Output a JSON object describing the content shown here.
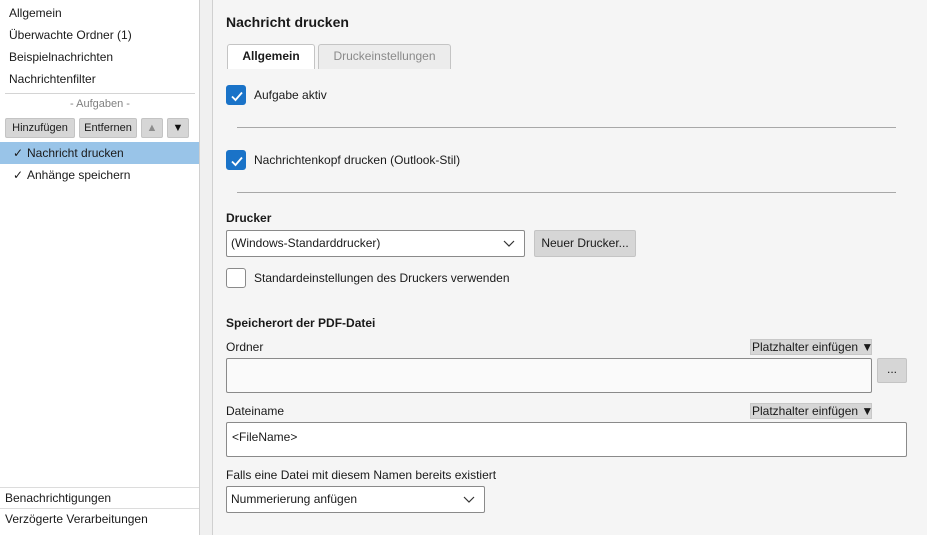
{
  "sidebar": {
    "nav_items": [
      "Allgemein",
      "Überwachte Ordner (1)",
      "Beispielnachrichten",
      "Nachrichtenfilter"
    ],
    "tasks_header": "- Aufgaben -",
    "toolbar": {
      "add_label": "Hinzufügen",
      "remove_label": "Entfernen",
      "up_glyph": "▲",
      "down_glyph": "▼"
    },
    "tasks": [
      {
        "check": "✓",
        "label": "Nachricht drucken",
        "selected": true
      },
      {
        "check": "✓",
        "label": "Anhänge speichern",
        "selected": false
      }
    ],
    "bottom_items": [
      "Benachrichtigungen",
      "Verzögerte Verarbeitungen"
    ]
  },
  "main": {
    "title": "Nachricht drucken",
    "tabs": [
      "Allgemein",
      "Druckeinstellungen"
    ],
    "task_active": {
      "label": "Aufgabe aktiv",
      "checked": true
    },
    "header_print": {
      "label": "Nachrichtenkopf drucken (Outlook-Stil)",
      "checked": true
    },
    "printer": {
      "section_label": "Drucker",
      "selected": "(Windows-Standarddrucker)",
      "new_printer_button": "Neuer Drucker...",
      "use_defaults_label": "Standardeinstellungen des Druckers verwenden",
      "use_defaults_checked": false
    },
    "pdf": {
      "section_label": "Speicherort der PDF-Datei",
      "folder_label": "Ordner",
      "folder_value": "",
      "placeholder_button": "Platzhalter einfügen ▼",
      "browse_button": "...",
      "filename_label": "Dateiname",
      "filename_value": "<FileName>",
      "exists_label": "Falls eine Datei mit diesem Namen bereits existiert",
      "exists_selected": "Nummerierung anfügen"
    }
  },
  "colors": {
    "accent": "#1a73c8",
    "selection": "#99c4e8"
  }
}
